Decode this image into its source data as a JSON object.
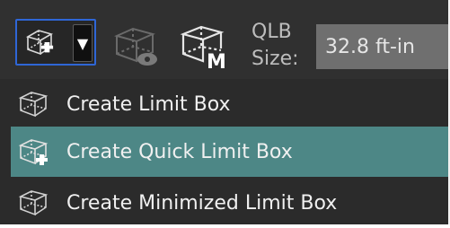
{
  "toolbar": {
    "buttons": [
      {
        "name": "create-quick-limit-box-dropdown",
        "icon": "quick-limit-box-icon",
        "state": "active"
      },
      {
        "name": "dropdown-arrow",
        "icon": "chevron-down-icon"
      },
      {
        "name": "show-limit-box",
        "icon": "limit-box-eye-icon",
        "state": "disabled"
      },
      {
        "name": "create-minimized-limit-box",
        "icon": "minimized-limit-box-icon"
      }
    ],
    "qlb_size_label_line1": "QLB",
    "qlb_size_label_line2": "Size:",
    "qlb_size_value": "32.8 ft-in"
  },
  "menu": {
    "items": [
      {
        "label": "Create Limit Box",
        "icon": "limit-box-icon",
        "selected": false
      },
      {
        "label": "Create Quick Limit Box",
        "icon": "quick-limit-box-icon",
        "selected": true
      },
      {
        "label": "Create Minimized Limit Box",
        "icon": "minimized-limit-box-icon",
        "selected": false
      }
    ]
  },
  "colors": {
    "background": "#2b2b2b",
    "selection": "#4d8786",
    "focus_border": "#2f66d6",
    "input_background": "#6f6f6f",
    "text": "#f0f0f0"
  }
}
